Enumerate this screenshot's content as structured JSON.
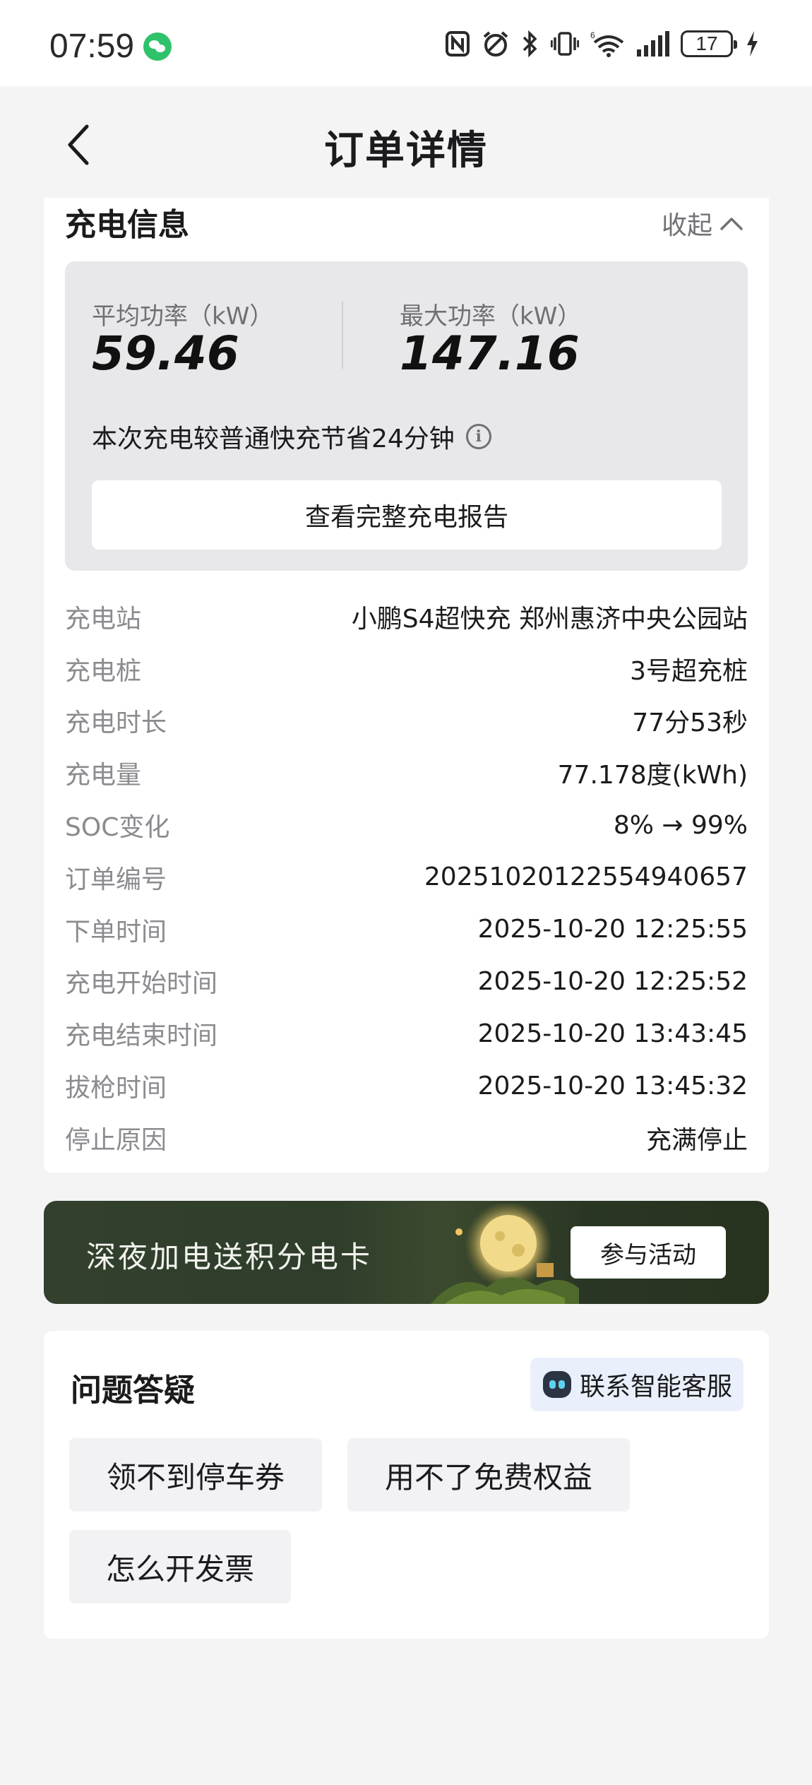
{
  "status_bar": {
    "time": "07:59",
    "battery": "17",
    "icons": [
      "wechat-icon",
      "nfc-icon",
      "alarm-icon",
      "bluetooth-icon",
      "vibrate-icon",
      "wifi-icon",
      "signal-icon",
      "battery-icon",
      "charging-icon"
    ]
  },
  "header": {
    "title": "订单详情",
    "back_icon": "chevron-left-icon"
  },
  "charge_info": {
    "title": "充电信息",
    "collapse_label": "收起",
    "avg_power_label": "平均功率（kW）",
    "avg_power_value": "59.46",
    "max_power_label": "最大功率（kW）",
    "max_power_value": "147.16",
    "saving_text": "本次充电较普通快充节省24分钟",
    "report_button": "查看完整充电报告",
    "details": [
      {
        "label": "充电站",
        "value": "小鹏S4超快充 郑州惠济中央公园站"
      },
      {
        "label": "充电桩",
        "value": "3号超充桩"
      },
      {
        "label": "充电时长",
        "value": "77分53秒"
      },
      {
        "label": "充电量",
        "value": "77.178度(kWh)"
      },
      {
        "label": "SOC变化",
        "value": "8% → 99%"
      },
      {
        "label": "订单编号",
        "value": "20251020122554940657"
      },
      {
        "label": "下单时间",
        "value": "2025-10-20 12:25:55"
      },
      {
        "label": "充电开始时间",
        "value": "2025-10-20 12:25:52"
      },
      {
        "label": "充电结束时间",
        "value": "2025-10-20 13:43:45"
      },
      {
        "label": "拔枪时间",
        "value": "2025-10-20 13:45:32"
      },
      {
        "label": "停止原因",
        "value": "充满停止"
      }
    ]
  },
  "banner": {
    "text": "深夜加电送积分电卡",
    "button": "参与活动"
  },
  "qa": {
    "title": "问题答疑",
    "service_button": "联系智能客服",
    "chips": [
      "领不到停车券",
      "用不了免费权益",
      "怎么开发票"
    ]
  },
  "colors": {
    "background": "#f4f4f5",
    "card": "#ffffff",
    "power_box": "#e8e8eb",
    "label_gray": "#8b8b90",
    "service_button_bg": "#eaf0fb",
    "banner_bg": "#32402d",
    "wechat_green": "#2ec26b"
  }
}
